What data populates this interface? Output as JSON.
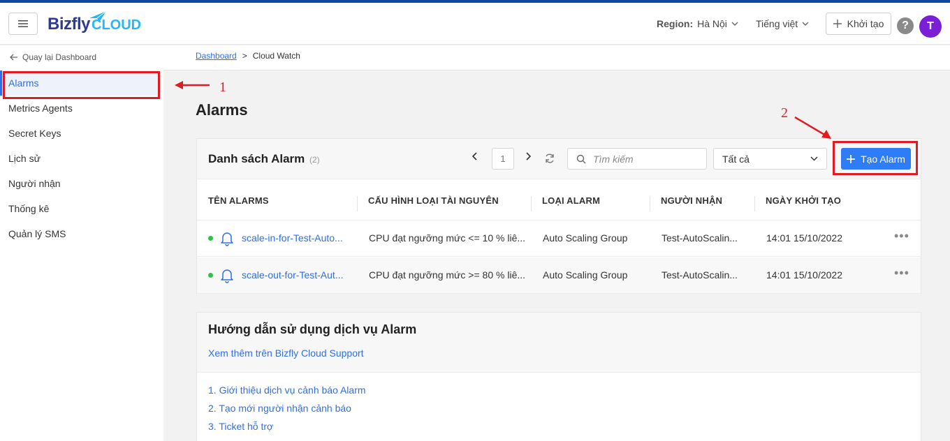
{
  "header": {
    "logo_main": "Bizfly",
    "logo_sub": "CLOUD",
    "region_label": "Region:",
    "region_value": "Hà Nội",
    "language": "Tiếng việt",
    "create_label": "Khởi tạo",
    "help_label": "?",
    "avatar_initial": "T"
  },
  "sidebar": {
    "back_label": "Quay lại Dashboard",
    "items": [
      {
        "label": "Alarms"
      },
      {
        "label": "Metrics Agents"
      },
      {
        "label": "Secret Keys"
      },
      {
        "label": "Lịch sử"
      },
      {
        "label": "Người nhận"
      },
      {
        "label": "Thống kê"
      },
      {
        "label": "Quản lý SMS"
      }
    ]
  },
  "breadcrumb": {
    "home": "Dashboard",
    "separator": ">",
    "current": "Cloud Watch"
  },
  "page_title": "Alarms",
  "alarm_list": {
    "title": "Danh sách Alarm",
    "count": "(2)",
    "page": "1",
    "search_placeholder": "Tìm kiếm",
    "filter_value": "Tất cả",
    "create_button": "Tạo Alarm",
    "columns": [
      "TÊN ALARMS",
      "CẤU HÌNH LOẠI TÀI NGUYÊN",
      "LOẠI ALARM",
      "NGƯỜI NHẬN",
      "NGÀY KHỞI TẠO"
    ],
    "rows": [
      {
        "name": "scale-in-for-Test-Auto...",
        "config": "CPU đạt ngưỡng mức <= 10 % liê...",
        "type": "Auto Scaling Group",
        "recipient": "Test-AutoScalin...",
        "created": "14:01 15/10/2022",
        "more": "•••"
      },
      {
        "name": "scale-out-for-Test-Aut...",
        "config": "CPU đạt ngưỡng mức >= 80 % liê...",
        "type": "Auto Scaling Group",
        "recipient": "Test-AutoScalin...",
        "created": "14:01 15/10/2022",
        "more": "•••"
      }
    ]
  },
  "guide": {
    "title": "Hướng dẫn sử dụng dịch vụ Alarm",
    "support_link": "Xem thêm trên Bizfly Cloud Support",
    "links": [
      "1. Giới thiệu dịch vụ cảnh báo Alarm",
      "2. Tạo mới người nhận cảnh báo",
      "3. Ticket hỗ trợ"
    ]
  },
  "annotations": {
    "num1": "1",
    "num2": "2",
    "color": "#e01b24"
  },
  "colors": {
    "accent": "#2e7cf6",
    "link": "#2e6fe6",
    "status_ok": "#2ec24a",
    "avatar": "#7b1fd6",
    "top_strip": "#0d47a1"
  }
}
